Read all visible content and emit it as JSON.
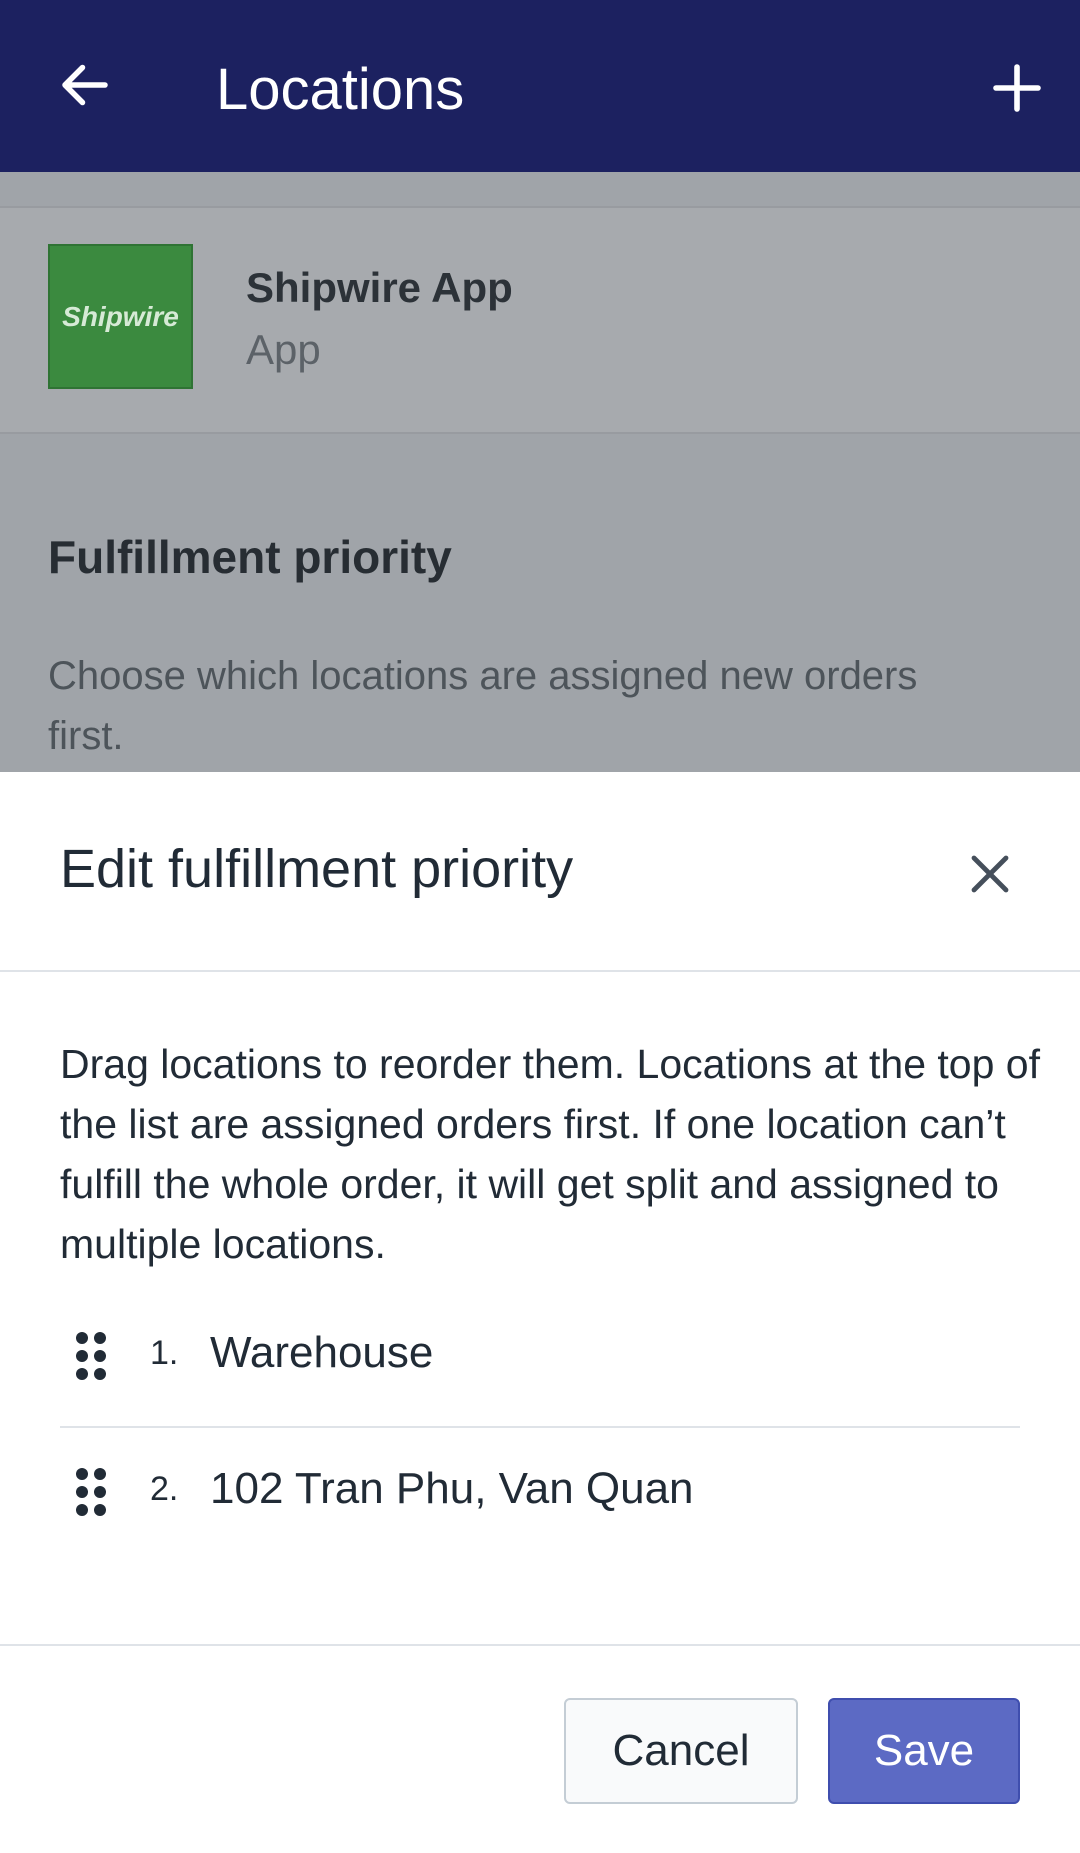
{
  "topbar": {
    "title": "Locations",
    "back_icon": "arrow-left-icon",
    "add_icon": "plus-icon",
    "background": "#1c2160"
  },
  "app_card": {
    "logo_text": "Shipwire",
    "name": "Shipwire App",
    "type": "App"
  },
  "fulfillment_section": {
    "title": "Fulfillment priority",
    "description": "Choose which locations are assigned new orders first."
  },
  "sheet": {
    "title": "Edit fulfillment priority",
    "close_icon": "close-icon",
    "description": "Drag locations to reorder them. Locations at the top of the list are assigned orders first. If one location can’t fulfill the whole order, it will get split and assigned to multiple locations.",
    "locations": [
      {
        "number": "1.",
        "name": "Warehouse"
      },
      {
        "number": "2.",
        "name": "102 Tran Phu, Van Quan"
      }
    ],
    "cancel_label": "Cancel",
    "save_label": "Save",
    "accent": "#5c6ac4"
  }
}
